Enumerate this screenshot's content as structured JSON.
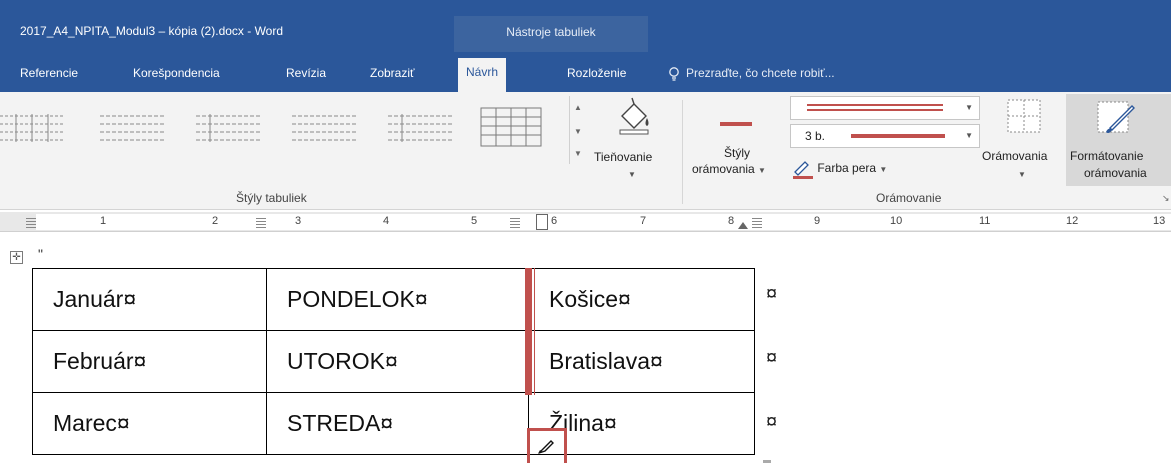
{
  "window": {
    "title": "2017_A4_NPITA_Modul3 – kópia (2).docx - Word",
    "context_tab_header": "Nástroje tabuliek"
  },
  "tabs": [
    {
      "label": "Referencie"
    },
    {
      "label": "Korešpondencia"
    },
    {
      "label": "Revízia"
    },
    {
      "label": "Zobraziť"
    },
    {
      "label": "Návrh",
      "active": true
    },
    {
      "label": "Rozloženie"
    }
  ],
  "tell_me": {
    "placeholder": "Prezraďte, čo chcete robiť...",
    "icon": "lightbulb-icon"
  },
  "ribbon": {
    "table_styles_group": "Štýly tabuliek",
    "shading": {
      "label": "Tieňovanie",
      "icon": "paint-bucket-icon"
    },
    "border_styles": {
      "label_line1": "Štýly",
      "label_line2": "orámovania",
      "icon": "border-style-icon"
    },
    "line_style_value": "solid",
    "pen_weight": "3 b.",
    "pen_color": {
      "label": "Farba pera",
      "icon": "pen-color-icon",
      "color": "#c0504d"
    },
    "borders": {
      "label": "Orámovania",
      "icon": "borders-icon"
    },
    "border_painter": {
      "label_line1": "Formátovanie",
      "label_line2": "orámovania",
      "icon": "border-painter-icon"
    },
    "borders_group": "Orámovanie"
  },
  "ruler": {
    "numbers": [
      "1",
      "2",
      "3",
      "4",
      "5",
      "6",
      "7",
      "8",
      "9",
      "10",
      "11",
      "12",
      "13"
    ]
  },
  "document": {
    "table": [
      [
        "Január¤",
        "PONDELOK¤",
        "Košice¤"
      ],
      [
        "Február¤",
        "UTOROK¤",
        "Bratislava¤"
      ],
      [
        "Marec¤",
        "STREDA¤",
        "Žilina¤"
      ]
    ],
    "row_end_mark": "¤",
    "paragraph_mark": "\""
  },
  "colors": {
    "accent": "#2b579a",
    "pen": "#c0504d"
  }
}
